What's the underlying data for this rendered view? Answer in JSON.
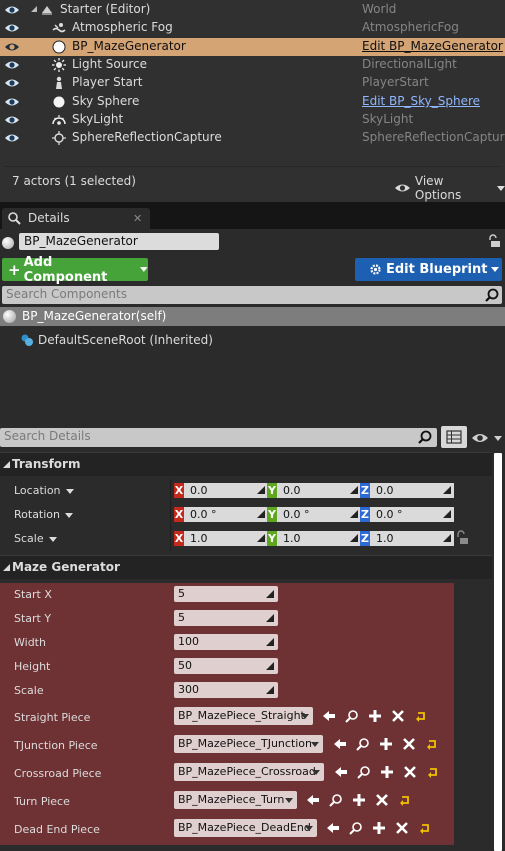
{
  "outliner": {
    "rows": [
      {
        "name": "Starter (Editor)",
        "type": "World",
        "icon": "world-icon"
      },
      {
        "name": "Atmospheric Fog",
        "type": "AtmosphericFog",
        "icon": "fog-icon"
      },
      {
        "name": "BP_MazeGenerator",
        "type": "Edit BP_MazeGenerator",
        "icon": "sphere-icon",
        "selected": true
      },
      {
        "name": "Light Source",
        "type": "DirectionalLight",
        "icon": "sun-icon"
      },
      {
        "name": "Player Start",
        "type": "PlayerStart",
        "icon": "player-start-icon"
      },
      {
        "name": "Sky Sphere",
        "type": "Edit BP_Sky_Sphere",
        "icon": "sphere-icon",
        "link": true
      },
      {
        "name": "SkyLight",
        "type": "SkyLight",
        "icon": "skylight-icon"
      },
      {
        "name": "SphereReflectionCapture",
        "type": "SphereReflectionCapture",
        "icon": "reflection-capture-icon"
      }
    ],
    "status": "7 actors (1 selected)",
    "view_options": "View Options"
  },
  "details": {
    "tab_label": "Details",
    "actor_name": "BP_MazeGenerator",
    "add_component": "Add Component",
    "edit_blueprint": "Edit Blueprint",
    "search_components_placeholder": "Search Components",
    "self_component": "BP_MazeGenerator(self)",
    "root_component": "DefaultSceneRoot (Inherited)",
    "search_details_placeholder": "Search Details"
  },
  "transform": {
    "title": "Transform",
    "rows": [
      {
        "label": "Location",
        "x": "0.0",
        "y": "0.0",
        "z": "0.0"
      },
      {
        "label": "Rotation",
        "x": "0.0 °",
        "y": "0.0 °",
        "z": "0.0 °"
      },
      {
        "label": "Scale",
        "x": "1.0",
        "y": "1.0",
        "z": "1.0"
      }
    ],
    "axis_labels": {
      "x": "X",
      "y": "Y",
      "z": "Z"
    }
  },
  "maze": {
    "title": "Maze Generator",
    "numeric": [
      {
        "label": "Start X",
        "value": "5"
      },
      {
        "label": "Start Y",
        "value": "5"
      },
      {
        "label": "Width",
        "value": "100"
      },
      {
        "label": "Height",
        "value": "50"
      },
      {
        "label": "Scale",
        "value": "300"
      }
    ],
    "assets": [
      {
        "label": "Straight Piece",
        "value": "BP_MazePiece_Straight"
      },
      {
        "label": "TJunction Piece",
        "value": "BP_MazePiece_TJunction"
      },
      {
        "label": "Crossroad Piece",
        "value": "BP_MazePiece_Crossroad"
      },
      {
        "label": "Turn Piece",
        "value": "BP_MazePiece_Turn"
      },
      {
        "label": "Dead End Piece",
        "value": "BP_MazePiece_DeadEnd"
      }
    ]
  },
  "colors": {
    "selected_row": "#d4a474",
    "add_component": "#46a33a",
    "edit_blueprint": "#1d5fb0",
    "maze_category_bg": "#6e3234",
    "axis_x": "#c5281c",
    "axis_y": "#5fa621",
    "axis_z": "#2d6ad8"
  }
}
